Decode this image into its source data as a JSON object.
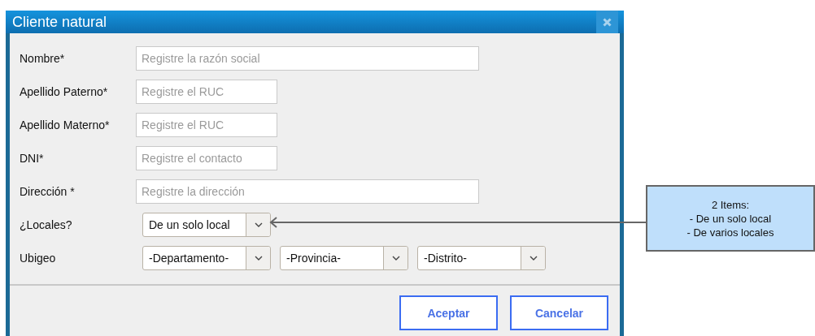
{
  "window": {
    "title": "Cliente natural"
  },
  "fields": [
    {
      "kind": "wide",
      "label": "Nombre*",
      "placeholder": "Registre la razón social"
    },
    {
      "kind": "narrow",
      "label": "Apellido Paterno*",
      "placeholder": "Registre el RUC"
    },
    {
      "kind": "narrow",
      "label": "Apellido Materno*",
      "placeholder": "Registre el RUC"
    },
    {
      "kind": "narrow",
      "label": "DNI*",
      "placeholder": "Registre el contacto"
    },
    {
      "kind": "wide",
      "label": "Dirección *",
      "placeholder": "Registre la dirección"
    },
    {
      "kind": "select",
      "label": "¿Locales?",
      "selects": [
        "De un solo local"
      ]
    },
    {
      "kind": "select",
      "label": "Ubigeo",
      "selects": [
        "-Departamento-",
        "-Provincia-",
        "-Distrito-"
      ]
    }
  ],
  "buttons": [
    "Aceptar",
    "Cancelar"
  ],
  "annotation": {
    "text": "2 Items:\n- De un solo local\n- De varios locales"
  }
}
